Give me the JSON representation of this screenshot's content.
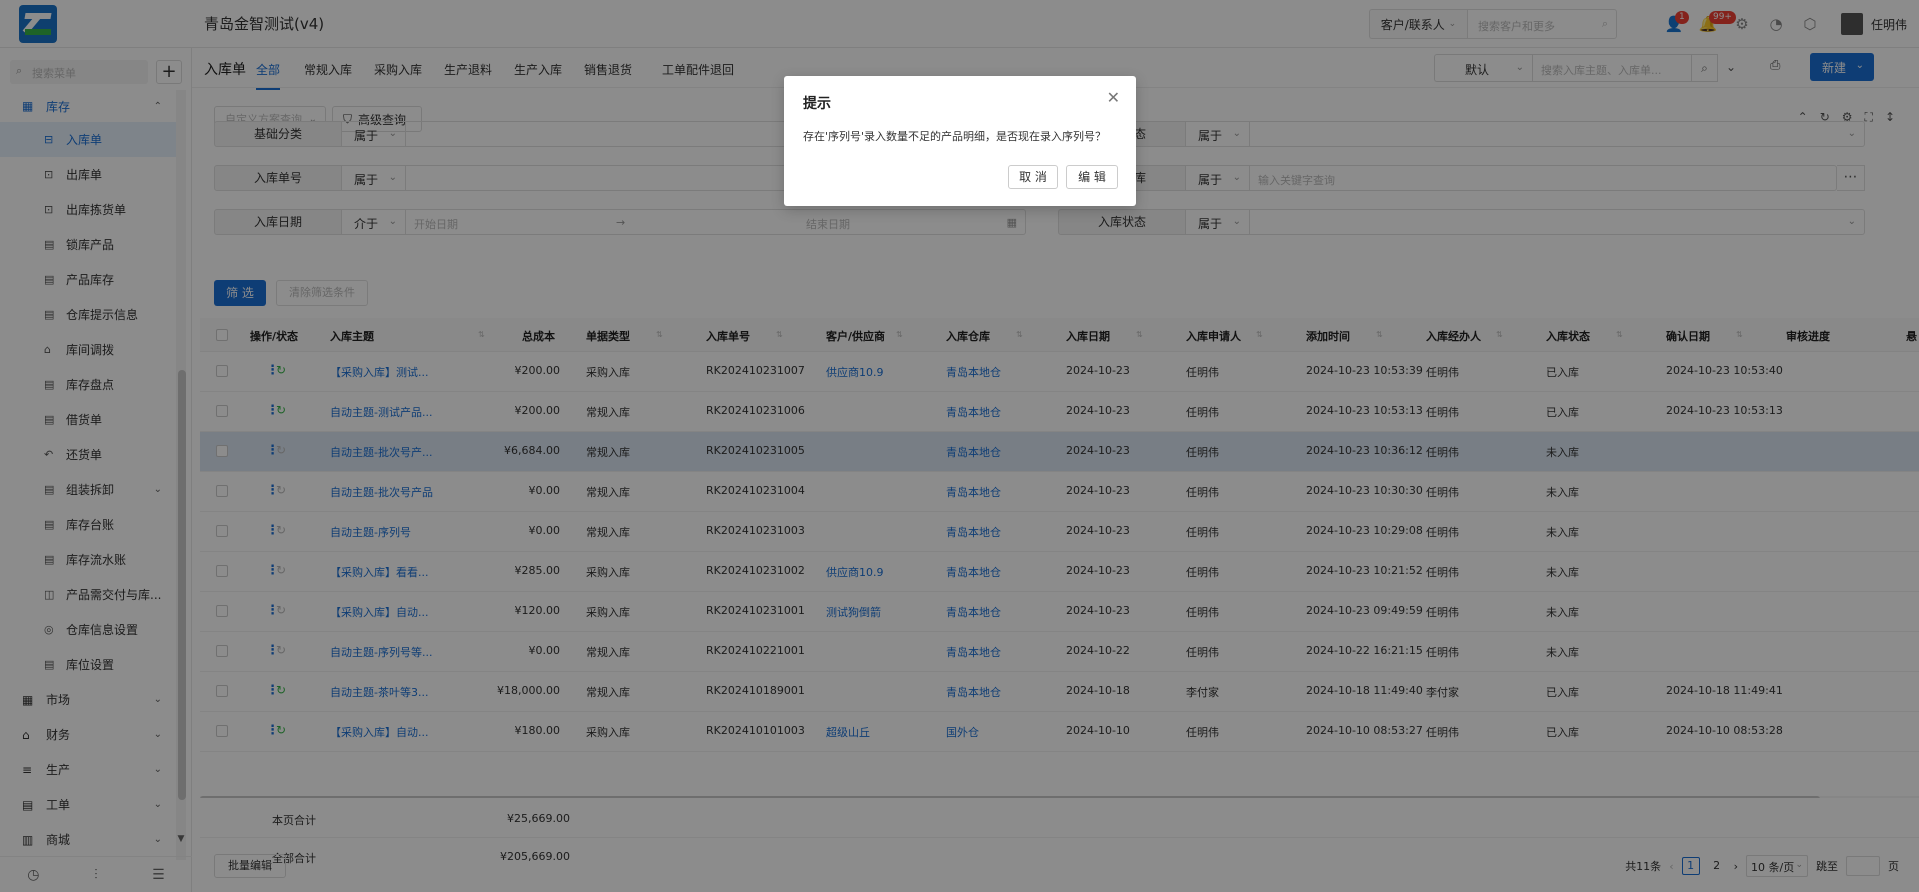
{
  "app": {
    "title": "青岛金智测试(v4)"
  },
  "header": {
    "customer_select": "客户/联系人",
    "search_placeholder": "搜索客户和更多",
    "notif_badge": "1",
    "msg_badge": "99+",
    "user_name": "任明伟"
  },
  "sidebar": {
    "search_placeholder": "搜索菜单",
    "add_label": "+",
    "group_inventory": "库存",
    "items": [
      {
        "label": "入库单",
        "icon": "inbound-icon"
      },
      {
        "label": "出库单",
        "icon": "outbound-icon"
      },
      {
        "label": "出库拣货单",
        "icon": "picking-icon"
      },
      {
        "label": "锁库产品",
        "icon": "lock-icon"
      },
      {
        "label": "产品库存",
        "icon": "stock-icon"
      },
      {
        "label": "仓库提示信息",
        "icon": "warning-icon"
      },
      {
        "label": "库间调拨",
        "icon": "transfer-icon"
      },
      {
        "label": "库存盘点",
        "icon": "count-icon"
      },
      {
        "label": "借货单",
        "icon": "borrow-icon"
      },
      {
        "label": "还货单",
        "icon": "return-icon"
      },
      {
        "label": "组装拆卸",
        "icon": "assemble-icon"
      },
      {
        "label": "库存台账",
        "icon": "ledger-icon"
      },
      {
        "label": "库存流水账",
        "icon": "flow-icon"
      },
      {
        "label": "产品需交付与库...",
        "icon": "delivery-icon"
      },
      {
        "label": "仓库信息设置",
        "icon": "settings-icon"
      },
      {
        "label": "库位设置",
        "icon": "location-icon"
      }
    ],
    "groups": [
      {
        "label": "市场",
        "icon": "market-icon"
      },
      {
        "label": "财务",
        "icon": "finance-icon"
      },
      {
        "label": "生产",
        "icon": "production-icon"
      },
      {
        "label": "工单",
        "icon": "workorder-icon"
      },
      {
        "label": "商城",
        "icon": "shop-icon"
      }
    ]
  },
  "tabs": {
    "page_label": "入库单",
    "items": [
      "全部",
      "常规入库",
      "采购入库",
      "生产退料",
      "生产入库",
      "销售退货",
      "工单配件退回"
    ],
    "view_select": "默认",
    "search_placeholder": "搜索入库主题、入库单...",
    "new_label": "新建"
  },
  "filters": {
    "custom_scheme": "自定义方案查询",
    "advanced": "高级查询",
    "rows": [
      {
        "label": "基础分类",
        "op": "属于",
        "placeholder": ""
      },
      {
        "label": "入库单号",
        "op": "属于",
        "placeholder": ""
      },
      {
        "label": "入库日期",
        "op": "介于",
        "start": "开始日期",
        "arrow": "→",
        "end": "结束日期"
      }
    ],
    "right_rows": [
      {
        "label": "入库状态",
        "op": "属于",
        "placeholder": ""
      },
      {
        "label": "入库仓库",
        "op": "属于",
        "placeholder": "输入关键字查询"
      },
      {
        "label": "入库状态",
        "op": "属于",
        "placeholder": ""
      }
    ],
    "filter_btn": "筛 选",
    "clear_btn": "清除筛选条件"
  },
  "table": {
    "columns": [
      "操作/状态",
      "入库主题",
      "总成本",
      "单据类型",
      "入库单号",
      "客户/供应商",
      "入库仓库",
      "入库日期",
      "入库申请人",
      "添加时间",
      "入库经办人",
      "入库状态",
      "确认日期",
      "审核进度",
      "悬"
    ],
    "rows": [
      {
        "subject": "【采购入库】测试...",
        "cost": "¥200.00",
        "type": "采购入库",
        "no": "RK202410231007",
        "partner": "供应商10.9",
        "warehouse": "青岛本地仓",
        "date": "2024-10-23",
        "applicant": "任明伟",
        "added": "2024-10-23 10:53:39",
        "handler": "任明伟",
        "status": "已入库",
        "confirm": "2024-10-23 10:53:40",
        "on": true
      },
      {
        "subject": "自动主题-测试产品...",
        "cost": "¥200.00",
        "type": "常规入库",
        "no": "RK202410231006",
        "partner": "",
        "warehouse": "青岛本地仓",
        "date": "2024-10-23",
        "applicant": "任明伟",
        "added": "2024-10-23 10:53:13",
        "handler": "任明伟",
        "status": "已入库",
        "confirm": "2024-10-23 10:53:13",
        "on": true
      },
      {
        "subject": "自动主题-批次号产...",
        "cost": "¥6,684.00",
        "type": "常规入库",
        "no": "RK202410231005",
        "partner": "",
        "warehouse": "青岛本地仓",
        "date": "2024-10-23",
        "applicant": "任明伟",
        "added": "2024-10-23 10:36:12",
        "handler": "任明伟",
        "status": "未入库",
        "confirm": "",
        "on": false
      },
      {
        "subject": "自动主题-批次号产品",
        "cost": "¥0.00",
        "type": "常规入库",
        "no": "RK202410231004",
        "partner": "",
        "warehouse": "青岛本地仓",
        "date": "2024-10-23",
        "applicant": "任明伟",
        "added": "2024-10-23 10:30:30",
        "handler": "任明伟",
        "status": "未入库",
        "confirm": "",
        "on": false
      },
      {
        "subject": "自动主题-序列号",
        "cost": "¥0.00",
        "type": "常规入库",
        "no": "RK202410231003",
        "partner": "",
        "warehouse": "青岛本地仓",
        "date": "2024-10-23",
        "applicant": "任明伟",
        "added": "2024-10-23 10:29:08",
        "handler": "任明伟",
        "status": "未入库",
        "confirm": "",
        "on": false
      },
      {
        "subject": "【采购入库】看看...",
        "cost": "¥285.00",
        "type": "采购入库",
        "no": "RK202410231002",
        "partner": "供应商10.9",
        "warehouse": "青岛本地仓",
        "date": "2024-10-23",
        "applicant": "任明伟",
        "added": "2024-10-23 10:21:52",
        "handler": "任明伟",
        "status": "未入库",
        "confirm": "",
        "on": false
      },
      {
        "subject": "【采购入库】自动...",
        "cost": "¥120.00",
        "type": "采购入库",
        "no": "RK202410231001",
        "partner": "测试狗倒箭",
        "warehouse": "青岛本地仓",
        "date": "2024-10-23",
        "applicant": "任明伟",
        "added": "2024-10-23 09:49:59",
        "handler": "任明伟",
        "status": "未入库",
        "confirm": "",
        "on": false
      },
      {
        "subject": "自动主题-序列号等...",
        "cost": "¥0.00",
        "type": "常规入库",
        "no": "RK202410221001",
        "partner": "",
        "warehouse": "青岛本地仓",
        "date": "2024-10-22",
        "applicant": "任明伟",
        "added": "2024-10-22 16:21:15",
        "handler": "任明伟",
        "status": "未入库",
        "confirm": "",
        "on": false
      },
      {
        "subject": "自动主题-茶叶等3...",
        "cost": "¥18,000.00",
        "type": "常规入库",
        "no": "RK202410189001",
        "partner": "",
        "warehouse": "青岛本地仓",
        "date": "2024-10-18",
        "applicant": "李付家",
        "added": "2024-10-18 11:49:40",
        "handler": "李付家",
        "status": "已入库",
        "confirm": "2024-10-18 11:49:41",
        "on": true
      },
      {
        "subject": "【采购入库】自动...",
        "cost": "¥180.00",
        "type": "采购入库",
        "no": "RK202410101003",
        "partner": "超级山丘",
        "warehouse": "国外仓",
        "date": "2024-10-10",
        "applicant": "任明伟",
        "added": "2024-10-10 08:53:27",
        "handler": "任明伟",
        "status": "已入库",
        "confirm": "2024-10-10 08:53:28",
        "on": true
      }
    ],
    "page_total_label": "本页合计",
    "page_total": "¥25,669.00",
    "all_total_label": "全部合计",
    "all_total": "¥205,669.00"
  },
  "footer": {
    "batch_edit": "批量编辑",
    "total": "共11条",
    "pages": [
      "1",
      "2"
    ],
    "page_size": "10 条/页",
    "jump_label": "跳至",
    "page_unit": "页"
  },
  "modal": {
    "title": "提示",
    "body": "存在'序列号'录入数量不足的产品明细，是否现在录入序列号？",
    "cancel": "取 消",
    "edit": "编 辑"
  }
}
